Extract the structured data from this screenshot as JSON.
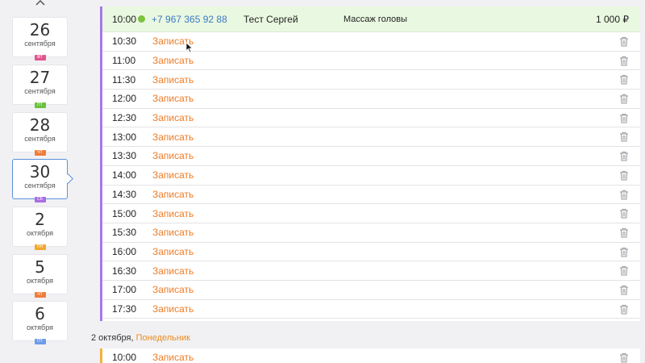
{
  "dates": [
    {
      "day": "26",
      "month": "сентября",
      "weekday": "ЖТ",
      "badge_color": "#e0558f",
      "selected": false
    },
    {
      "day": "27",
      "month": "сентября",
      "weekday": "ПТ",
      "badge_color": "#6bc13e",
      "selected": false
    },
    {
      "day": "28",
      "month": "сентября",
      "weekday": "ЧТ",
      "badge_color": "#ee7d3b",
      "selected": false
    },
    {
      "day": "30",
      "month": "сентября",
      "weekday": "СБ",
      "badge_color": "#a86de0",
      "selected": true
    },
    {
      "day": "2",
      "month": "октября",
      "weekday": "ПН",
      "badge_color": "#f3a72e",
      "selected": false
    },
    {
      "day": "5",
      "month": "октября",
      "weekday": "ЧТ",
      "badge_color": "#ee7d3b",
      "selected": false
    },
    {
      "day": "6",
      "month": "октября",
      "weekday": "ПТ",
      "badge_color": "#6e9be8",
      "selected": false
    }
  ],
  "booking": {
    "time": "10:00",
    "phone": "+7 967 365 92 88",
    "client": "Тест Сергей",
    "service": "Массаж головы",
    "price": "1 000 ₽"
  },
  "book_label": "Записать",
  "slots": [
    "10:30",
    "11:00",
    "11:30",
    "12:00",
    "12:30",
    "13:00",
    "13:30",
    "14:00",
    "14:30",
    "15:00",
    "15:30",
    "16:00",
    "16:30",
    "17:00",
    "17:30"
  ],
  "next_group": {
    "date": "2 октября,",
    "weekday": "Понедельник"
  },
  "next_slots": [
    "10:00"
  ]
}
